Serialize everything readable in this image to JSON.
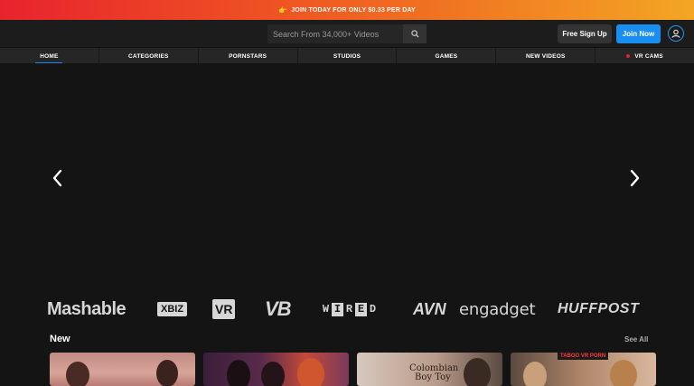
{
  "promo": {
    "text": "JOIN TODAY FOR ONLY $0.33 PER DAY",
    "icon": "pointing-hand-icon"
  },
  "header": {
    "search_placeholder": "Search From 34,000+ Videos",
    "free_signup": "Free Sign Up",
    "join_now": "Join Now"
  },
  "nav": {
    "home": "HOME",
    "categories": "CATEGORIES",
    "pornstars": "PORNSTARS",
    "studios": "STUDIOS",
    "games": "GAMES",
    "new_videos": "NEW VIDEOS",
    "vr_cams": "VR CAMS"
  },
  "press": {
    "mashable": "Mashable",
    "xbiz": "XBIZ",
    "vr": "VR",
    "vb": "VB",
    "wired": [
      "W",
      "I",
      "R",
      "E",
      "D"
    ],
    "avn": "AVN",
    "engadget": "engadget",
    "huffpost": "HUFFPOST"
  },
  "section": {
    "title": "New",
    "see_all": "See All"
  },
  "thumbs": {
    "t3_caption_line1": "Colombian",
    "t3_caption_line2": "Boy Toy",
    "t4_badge": "TABOO VR PORN"
  },
  "colors": {
    "accent": "#1a8ef0",
    "promo_start": "#e8232d",
    "promo_end": "#f3a623"
  }
}
